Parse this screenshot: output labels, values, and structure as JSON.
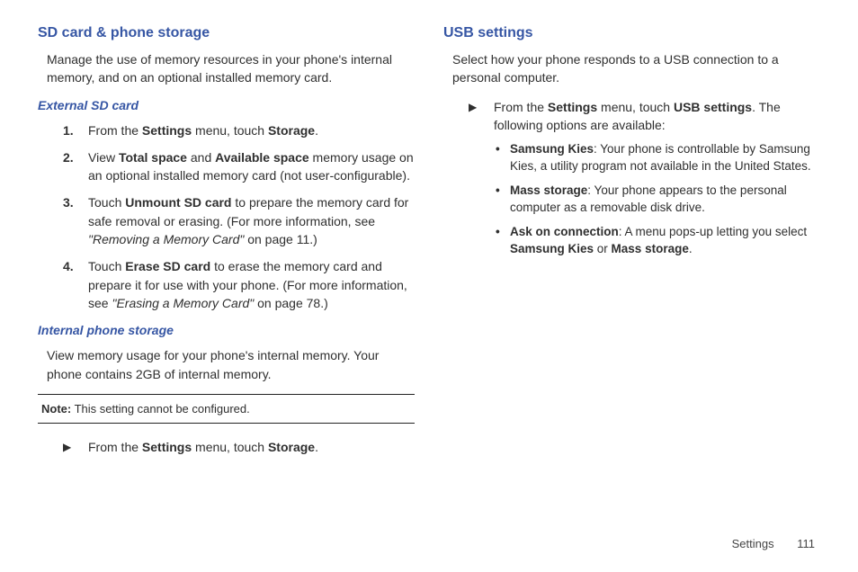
{
  "left": {
    "h1": "SD card & phone storage",
    "intro": "Manage the use of memory resources in your phone's internal memory, and on an optional installed memory card.",
    "sec1": {
      "h2": "External SD card",
      "steps": [
        {
          "num": "1.",
          "pre": "From the ",
          "b1": "Settings",
          "mid": " menu, touch ",
          "b2": "Storage",
          "post": "."
        },
        {
          "num": "2.",
          "pre": "View ",
          "b1": "Total space",
          "mid": " and ",
          "b2": "Available space",
          "post": " memory usage on an optional installed memory card (not user-configurable)."
        },
        {
          "num": "3.",
          "pre": "Touch ",
          "b1": "Unmount SD card",
          "mid": " to prepare the memory card for safe removal or erasing. (For more information, see ",
          "i1": "\"Removing a Memory Card\"",
          "post2": " on page 11.)"
        },
        {
          "num": "4.",
          "pre": "Touch ",
          "b1": "Erase SD card",
          "mid": " to erase the memory card and prepare it for use with your phone. (For more information, see ",
          "i1": "\"Erasing a Memory Card\"",
          "post2": " on page 78.)"
        }
      ]
    },
    "sec2": {
      "h2": "Internal phone storage",
      "intro": "View memory usage for your phone's internal memory. Your phone contains 2GB of internal memory.",
      "note_label": "Note:",
      "note_text": " This setting cannot be configured.",
      "arrow_pre": "From the ",
      "arrow_b1": "Settings",
      "arrow_mid": " menu, touch ",
      "arrow_b2": "Storage",
      "arrow_post": "."
    }
  },
  "right": {
    "h1": "USB settings",
    "intro": "Select how your phone responds to a USB connection to a personal computer.",
    "arrow_pre": "From the ",
    "arrow_b1": "Settings",
    "arrow_mid": " menu, touch ",
    "arrow_b2": "USB settings",
    "arrow_post": ". The following options are available:",
    "bullets": [
      {
        "b": "Samsung Kies",
        "t": ": Your phone is controllable by Samsung Kies, a utility program not available in the United States."
      },
      {
        "b": "Mass storage",
        "t": ": Your phone appears to the personal computer as a removable disk drive."
      },
      {
        "b": "Ask on connection",
        "t_pre": ": A menu pops-up letting you select ",
        "b2": "Samsung Kies",
        "t_mid": " or ",
        "b3": "Mass storage",
        "t_post": "."
      }
    ]
  },
  "footer": {
    "section": "Settings",
    "page": "111"
  }
}
